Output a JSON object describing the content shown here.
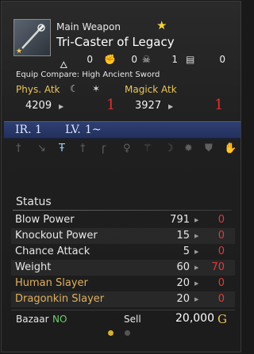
{
  "item": {
    "type": "Main Weapon",
    "name": "Tri-Caster of Legacy",
    "resistances": [
      {
        "icon": "flame-icon",
        "value": "0"
      },
      {
        "icon": "fist-icon",
        "value": "0"
      },
      {
        "icon": "skull-icon",
        "value": "1"
      },
      {
        "icon": "chest-icon",
        "value": "0"
      }
    ],
    "compare": "Equip Compare: High Ancient Sword"
  },
  "attack": {
    "phys_label": "Phys. Atk",
    "magick_label": "Magick Atk",
    "phys_value": "4209",
    "phys_diff": "1",
    "magick_value": "3927",
    "magick_diff": "1"
  },
  "rank": {
    "ir_label": "IR.",
    "ir_value": "1",
    "lv_label": "LV.",
    "lv_value": "1~"
  },
  "status": {
    "title": "Status",
    "rows": [
      {
        "label": "Blow Power",
        "value": "791",
        "diff": "0"
      },
      {
        "label": "Knockout Power",
        "value": "15",
        "diff": "0"
      },
      {
        "label": "Chance Attack",
        "value": "5",
        "diff": "0"
      },
      {
        "label": "Weight",
        "value": "60",
        "diff": "70"
      },
      {
        "label": "Human Slayer",
        "value": "20",
        "diff": "0"
      },
      {
        "label": "Dragonkin Slayer",
        "value": "20",
        "diff": "0"
      }
    ]
  },
  "footer": {
    "bazaar_label": "Bazaar",
    "bazaar_value": "NO",
    "sell_label": "Sell",
    "sell_price": "20,000",
    "currency": "G"
  },
  "colors": {
    "accent_gold": "#e9c55a",
    "diff_red": "#e03a3a",
    "ir_bar": "#2f3f73",
    "bazaar_green": "#6ad06a"
  }
}
